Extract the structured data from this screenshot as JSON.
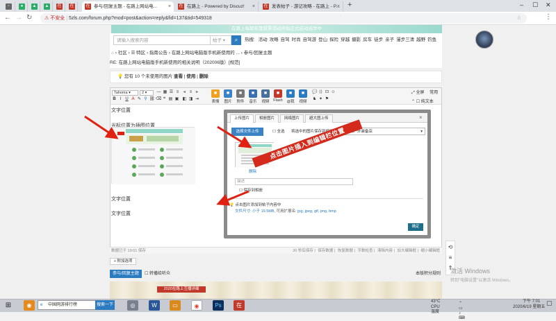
{
  "browser": {
    "tabs": [
      {
        "label": "参与/回复主题 - 在路上网站电...",
        "fav": "在",
        "active": true
      },
      {
        "label": "在路上 - Powered by Discuz!",
        "fav": "在",
        "active": false
      },
      {
        "label": "发表帖子 - 游记攻略 - 在路上 - P...",
        "fav": "在",
        "active": false
      }
    ],
    "insecure_label": "不安全",
    "url": "5zls.com/forum.php?mod=post&action=reply&fid=137&tid=549318"
  },
  "page": {
    "banner_text": "在路上每期年度投票活动开始正式启动选举中",
    "search_placeholder": "请输入搜索内容",
    "search_type": "帖子",
    "hot_label": "热搜:",
    "hot_items": [
      "活动",
      "攻略",
      "自驾",
      "时尚",
      "自驾游",
      "登山",
      "探险",
      "穿越",
      "摄影",
      "房车",
      "徒步",
      "亲子",
      "漫步三清",
      "越野",
      "钓鱼"
    ],
    "breadcrumb": [
      "社区",
      "特区",
      "指南公告",
      "在路上网站电脑版手机新使用的 ...",
      "参与/回复主题"
    ],
    "topic": "RE: 在路上网站电脑版手机新使用的相关说明（202006版）[规范]",
    "tip": {
      "prefix": "您有 10 个未使用的图片",
      "view": "查看",
      "use": "使用",
      "delete": "删除"
    }
  },
  "editor": {
    "font_name": "Tahoma",
    "font_size": "2",
    "big_icons": [
      {
        "label": "表情",
        "icon": "smile-icon",
        "color": "#f0a020"
      },
      {
        "label": "图片",
        "icon": "image-icon",
        "color": "#3a84c6"
      },
      {
        "label": "附件",
        "icon": "paperclip-icon",
        "color": "#777777"
      },
      {
        "label": "音乐",
        "icon": "music-icon",
        "color": "#3a6fb0"
      },
      {
        "label": "视频",
        "icon": "video-icon",
        "color": "#4a6f9a"
      },
      {
        "label": "Flash",
        "icon": "flash-icon",
        "color": "#c0392b"
      },
      {
        "label": "@我",
        "icon": "at-icon",
        "color": "#2b7bc0"
      },
      {
        "label": "视频",
        "icon": "play-icon",
        "color": "#2b7bc0"
      }
    ],
    "fullscreen": "全屏",
    "common": "常用",
    "plain_text": "纯文本",
    "content": {
      "line1": "文字位置",
      "line2": "光标位置为插图位置",
      "line3": "文字位置",
      "line4": "文字位置"
    },
    "status_left": "数据已于 19:01 保存",
    "status_right": [
      "20 秒后保存",
      "保存数据",
      "恢复数据",
      "字数检查",
      "清除内容",
      "加大编辑框",
      "缩小编辑框"
    ]
  },
  "dialog": {
    "tabs": [
      "上传图片",
      "相册图片",
      "网络图片",
      "超大图上传"
    ],
    "select_upload": "选择文件上传",
    "select_all": "全选",
    "save_album_label": "将选中的图片保存到相册:",
    "album_value": "在路上户外装备店",
    "delete_link": "删除",
    "desc_placeholder": "描述",
    "save_to_album": "保存到相册",
    "note1": "点击图片添加到帖子内容中",
    "note2_prefix": "文件尺寸:",
    "note2_size": "小于 19.5MB",
    "note2_mid": ", 可用扩展名:",
    "note2_ext": "jpg, jpeg, gif, png, bmp",
    "ok": "确定"
  },
  "overlay_label": "点击图片插入到编辑栏位置",
  "bottom": {
    "add_option": "+ 附加选项",
    "submit": "参与/回复主题",
    "forward": "转播给听众",
    "rules": "本版积分规则",
    "footer_label": "2020在路上互播详细"
  },
  "windows_activate": {
    "line1": "激活 Windows",
    "line2": "转到\"电脑设置\"以激活 Windows。"
  },
  "taskbar": {
    "search_text": "中国网游排行榜",
    "search_btn": "搜索一下",
    "temp": "43°C",
    "cpu": "CPU温度",
    "time": "下午 7:01",
    "date": "2020/6/19 星期五"
  },
  "colors": {
    "accent": "#2b7bc0",
    "arrow": "#e02010",
    "label_red": "#d42a1c"
  }
}
